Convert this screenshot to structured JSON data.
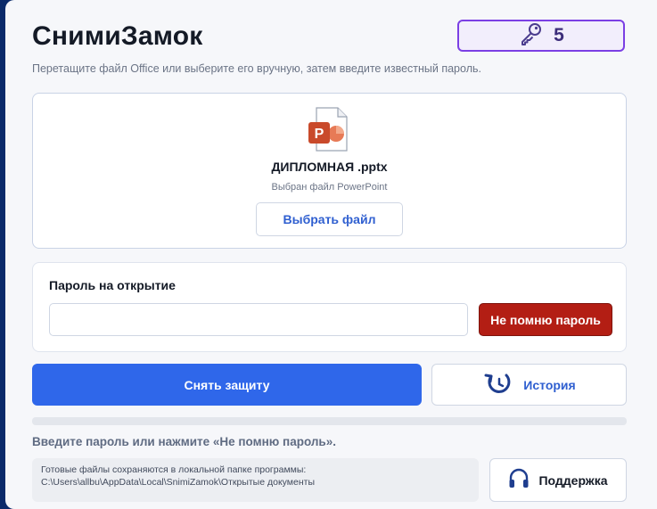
{
  "app": {
    "title": "СнимиЗамок",
    "subtitle": "Перетащите файл Office или выберите его вручную, затем введите известный пароль."
  },
  "counter": {
    "icon": "key-icon",
    "value": "5",
    "accent": "#7b3fe4"
  },
  "file": {
    "icon": "powerpoint-file-icon",
    "name": "ДИПЛОМНАЯ .pptx",
    "type_text": "Выбран файл PowerPoint",
    "choose_label": "Выбрать файл"
  },
  "password": {
    "label": "Пароль на открытие",
    "value": "",
    "placeholder": "",
    "forgot_label": "Не помню пароль"
  },
  "actions": {
    "unlock_label": "Снять защиту",
    "history_label": "История",
    "history_icon": "history-icon"
  },
  "progress": {
    "fraction": 0
  },
  "status": {
    "hint": "Введите пароль или нажмите «Не помню пароль»."
  },
  "footer": {
    "saved_line1": "Готовые файлы сохраняются в локальной папке программы:",
    "saved_line2": "C:\\Users\\allbu\\AppData\\Local\\SnimiZamok\\Открытые документы",
    "support_label": "Поддержка",
    "support_icon": "headphones-icon"
  },
  "colors": {
    "primary": "#2f67ea",
    "danger": "#b31e14",
    "powerpoint": "#c94a2b"
  }
}
